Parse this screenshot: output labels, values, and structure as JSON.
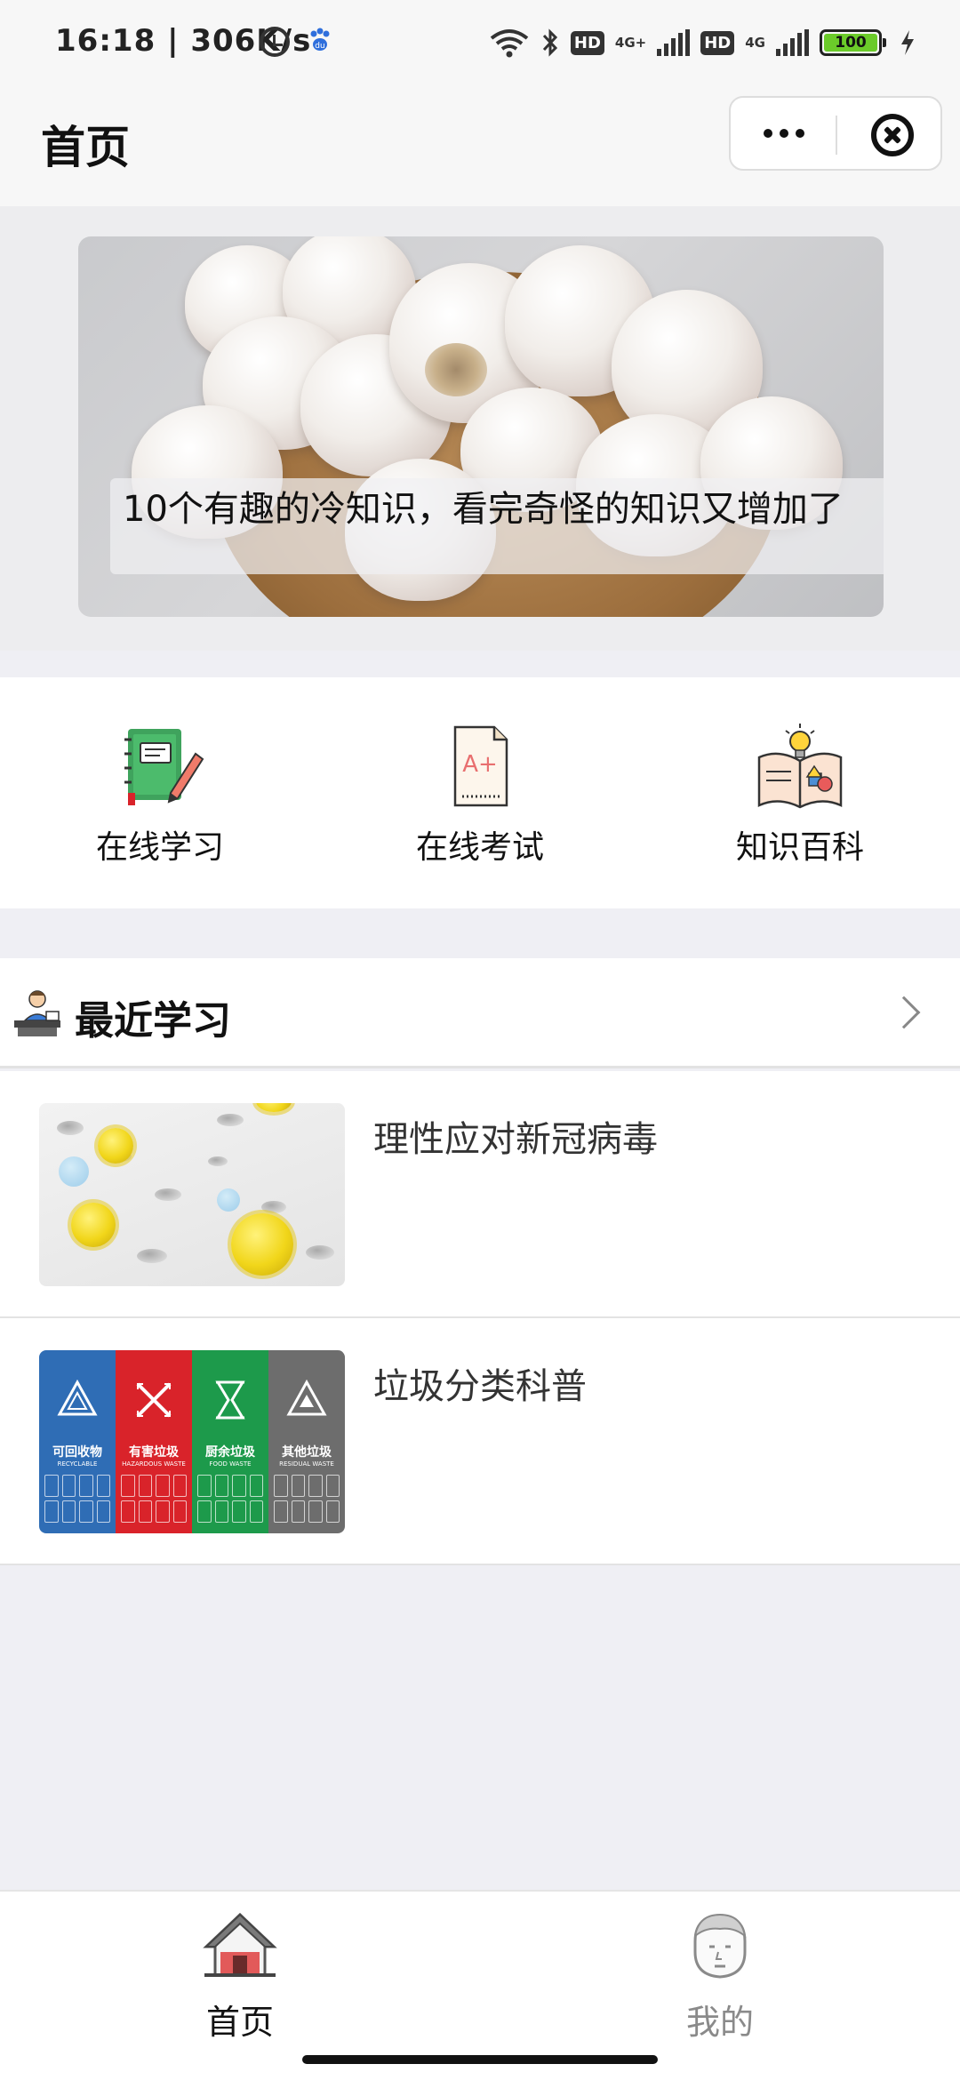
{
  "status_bar": {
    "time": "16:18",
    "speed": "| 306K/s",
    "hd1": "HD",
    "net1": "4G+",
    "hd2": "HD",
    "net2": "4G",
    "battery": "100",
    "icons": [
      "alarm-icon",
      "baidu-paw-icon",
      "wifi-icon",
      "bluetooth-icon",
      "signal-icon",
      "battery-icon",
      "charging-icon"
    ]
  },
  "nav": {
    "title": "首页",
    "more_icon": "more-dots-icon",
    "close_icon": "close-circle-icon"
  },
  "banner": {
    "caption": "10个有趣的冷知识，看完奇怪的知识又增加了"
  },
  "menu": {
    "items": [
      {
        "label": "在线学习",
        "icon": "notebook-pencil-icon"
      },
      {
        "label": "在线考试",
        "icon": "exam-paper-icon"
      },
      {
        "label": "知识百科",
        "icon": "open-book-bulb-icon"
      }
    ]
  },
  "recent": {
    "title": "最近学习",
    "icon": "student-desk-icon",
    "items": [
      {
        "title": "理性应对新冠病毒"
      },
      {
        "title": "垃圾分类科普"
      }
    ]
  },
  "bins": [
    {
      "name": "可回收物",
      "sub": "RECYCLABLE",
      "color": "#2f6db5"
    },
    {
      "name": "有害垃圾",
      "sub": "HAZARDOUS WASTE",
      "color": "#d9232a"
    },
    {
      "name": "厨余垃圾",
      "sub": "FOOD WASTE",
      "color": "#1d9a4b"
    },
    {
      "name": "其他垃圾",
      "sub": "RESIDUAL WASTE",
      "color": "#6d6d6d"
    }
  ],
  "tabbar": {
    "tabs": [
      {
        "label": "首页",
        "icon": "house-icon",
        "active": true
      },
      {
        "label": "我的",
        "icon": "person-face-icon",
        "active": false
      }
    ]
  }
}
